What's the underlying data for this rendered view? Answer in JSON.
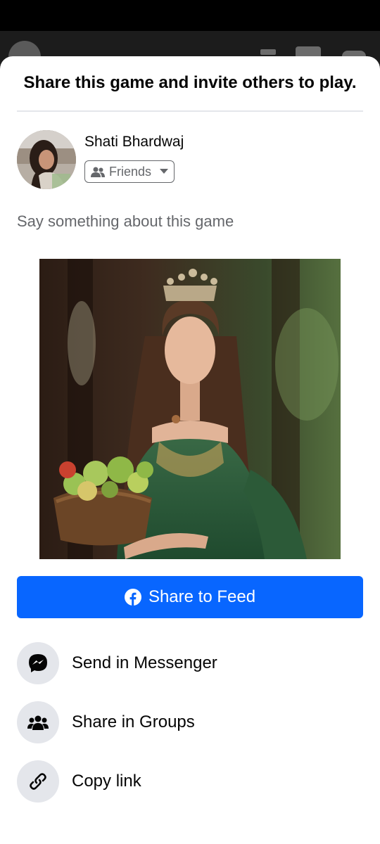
{
  "sheet": {
    "title": "Share this game and invite others to play."
  },
  "user": {
    "name": "Shati Bhardwaj",
    "audience": "Friends"
  },
  "composer": {
    "placeholder": "Say something about this game"
  },
  "share_feed": {
    "label": "Share to Feed",
    "color": "#0866ff"
  },
  "options": [
    {
      "icon": "messenger-icon",
      "label": "Send in Messenger"
    },
    {
      "icon": "groups-icon",
      "label": "Share in Groups"
    },
    {
      "icon": "link-icon",
      "label": "Copy link"
    }
  ]
}
